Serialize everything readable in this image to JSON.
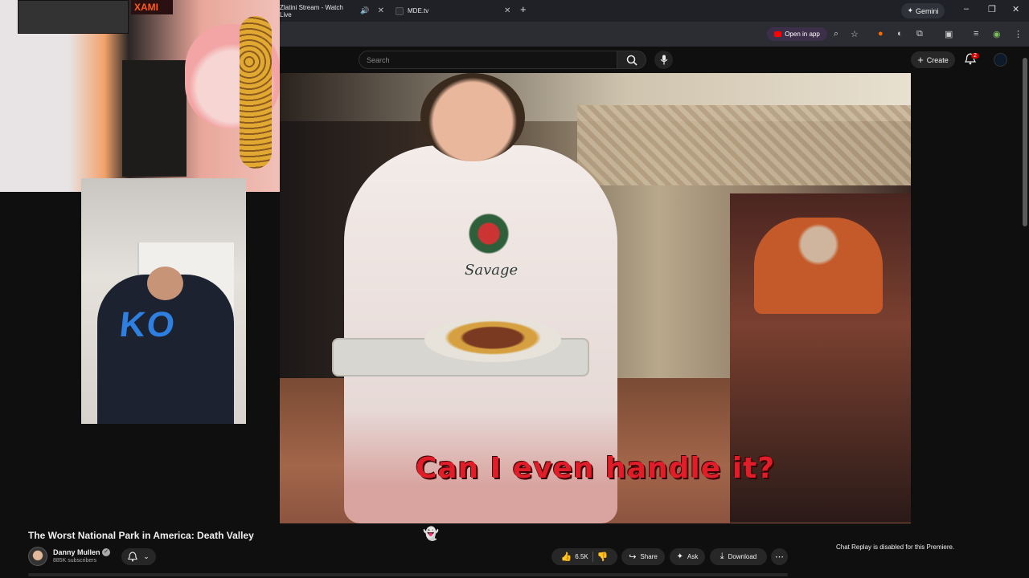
{
  "browser": {
    "tabs": [
      {
        "label": "Zlatini Stream - Watch Live",
        "muted": true
      },
      {
        "label": "MDE.tv"
      }
    ],
    "gemini_label": "Gemini",
    "open_in_app_label": "Open in app"
  },
  "youtube": {
    "search_placeholder": "Search",
    "create_label": "Create",
    "notification_count": "2"
  },
  "overlays": {
    "poster_text": "XAMI",
    "shirt_text": "KO"
  },
  "video": {
    "caption": "Can I even handle it?",
    "shirt_text": "Savage"
  },
  "info": {
    "title": "The Worst National Park in America: Death Valley",
    "channel_name": "Danny Mullen",
    "subscribers": "885K subscribers",
    "likes": "6.5K",
    "share_label": "Share",
    "ask_label": "Ask",
    "download_label": "Download",
    "chat_replay": "Chat Replay is disabled for this Premiere."
  },
  "colors": {
    "accent": "#ff0000",
    "caption": "#e01e2a",
    "background": "#0f0f0f"
  }
}
